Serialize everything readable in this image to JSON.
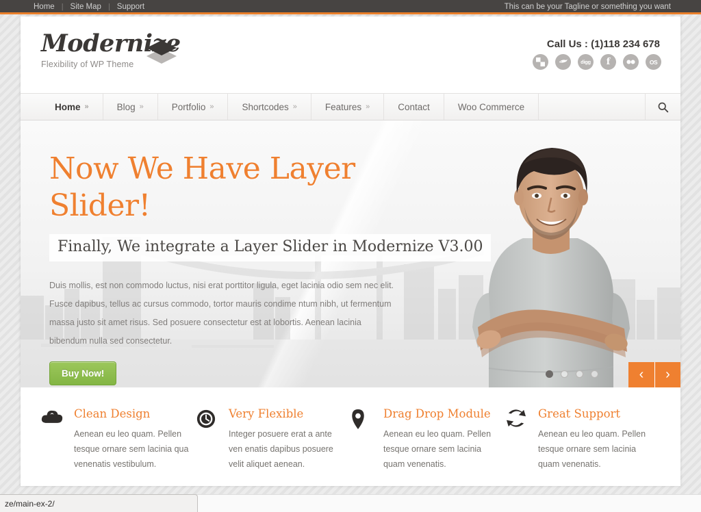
{
  "topbar": {
    "links": [
      "Home",
      "Site Map",
      "Support"
    ],
    "separator": "|",
    "tagline": "This can be your Tagline or something you want"
  },
  "header": {
    "logo_name": "Modernize",
    "logo_tagline": "Flexibility of WP Theme",
    "logo_icon": "layers-diamond-icon",
    "call_us": "Call Us : (1)118 234 678",
    "socials": [
      {
        "name": "delicious-icon",
        "label": "delicious"
      },
      {
        "name": "deviantart-icon",
        "label": "deviantart"
      },
      {
        "name": "digg-icon",
        "label": "digg"
      },
      {
        "name": "facebook-icon",
        "label": "f"
      },
      {
        "name": "flickr-icon",
        "label": "flickr"
      },
      {
        "name": "lastfm-icon",
        "label": "last.fm"
      }
    ]
  },
  "nav": {
    "items": [
      {
        "label": "Home",
        "caret": "»",
        "active": true
      },
      {
        "label": "Blog",
        "caret": "»",
        "active": false
      },
      {
        "label": "Portfolio",
        "caret": "»",
        "active": false
      },
      {
        "label": "Shortcodes",
        "caret": "»",
        "active": false
      },
      {
        "label": "Features",
        "caret": "»",
        "active": false
      },
      {
        "label": "Contact",
        "caret": "",
        "active": false
      },
      {
        "label": "Woo Commerce",
        "caret": "",
        "active": false
      }
    ],
    "search_icon": "search-icon"
  },
  "hero": {
    "title": "Now We Have Layer Slider!",
    "subtitle": "Finally, We integrate a Layer Slider in Modernize V3.00",
    "paragraph": "Duis mollis, est non commodo luctus, nisi erat porttitor ligula, eget lacinia odio sem nec elit. Fusce dapibus, tellus ac cursus commodo, tortor mauris condime ntum nibh, ut fermentum massa justo sit amet risus. Sed posuere consectetur est at lobortis. Aenean lacinia bibendum nulla sed consectetur.",
    "button_label": "Buy Now!",
    "dots": 4,
    "active_dot": 0,
    "prev_label": "‹",
    "next_label": "›"
  },
  "features": [
    {
      "icon": "cloud-icon",
      "title": "Clean Design",
      "text": "Aenean eu leo quam. Pellen tesque ornare sem lacinia qua venenatis vestibulum."
    },
    {
      "icon": "clock-icon",
      "title": "Very Flexible",
      "text": "Integer posuere erat a ante ven enatis dapibus posuere velit aliquet aenean."
    },
    {
      "icon": "map-pin-icon",
      "title": "Drag Drop Module",
      "text": "Aenean eu leo quam. Pellen tesque ornare sem lacinia quam venenatis."
    },
    {
      "icon": "sync-arrows-icon",
      "title": "Great Support",
      "text": "Aenean eu leo quam. Pellen tesque ornare sem lacinia quam venenatis."
    }
  ],
  "status": {
    "url_text": "ze/main-ex-2/"
  },
  "colors": {
    "accent_orange": "#ef8030",
    "topbar_dark": "#474442",
    "button_green": "#8fbd4e",
    "text_gray": "#76736f"
  }
}
